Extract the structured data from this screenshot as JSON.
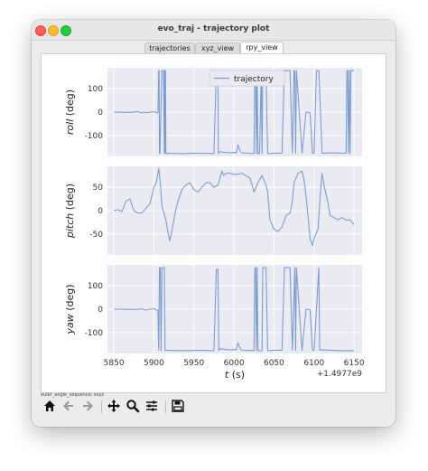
{
  "window": {
    "title": "evo_traj - trajectory plot"
  },
  "tabs": [
    {
      "label": "trajectories",
      "active": false
    },
    {
      "label": "xyz_view",
      "active": false
    },
    {
      "label": "rpy_view",
      "active": true
    }
  ],
  "caption": "euler_angle_sequence: sxyz",
  "toolbar": {
    "icons": [
      "home-icon",
      "back-arrow-icon",
      "forward-arrow-icon",
      "pan-icon",
      "zoom-icon",
      "configure-subplots-icon",
      "save-icon"
    ]
  },
  "colors": {
    "plot_bg": "#eaeaf2",
    "series": "#7b9ccf"
  },
  "chart_data": [
    {
      "type": "line",
      "ylabel_italic": "roll",
      "ylabel_unit": "(deg)",
      "yticks": [
        100,
        0,
        -100
      ],
      "ylim": [
        -190,
        190
      ],
      "xlim": [
        5842,
        6160
      ],
      "legend": {
        "placement": "top-center",
        "entries": [
          "trajectory"
        ]
      },
      "grid": true,
      "series": [
        {
          "name": "trajectory",
          "x": [
            5850,
            5870,
            5880,
            5885,
            5888,
            5890,
            5895,
            5900,
            5902,
            5903,
            5904,
            5905,
            5906,
            5906.5,
            5907,
            5907.5,
            5910,
            5911,
            5912,
            5913,
            5913.5,
            5914,
            5914.5,
            5915,
            5917,
            5918,
            5920,
            5935,
            5950,
            5965,
            5975,
            5978,
            5980,
            5980.5,
            5982,
            5995,
            6000,
            6003,
            6005,
            6008,
            6010,
            6020,
            6025,
            6026,
            6027,
            6028,
            6029,
            6030,
            6032,
            6034,
            6035,
            6036,
            6037,
            6040,
            6042,
            6043,
            6050,
            6060,
            6063,
            6070,
            6073,
            6075,
            6076,
            6077,
            6078,
            6085,
            6090,
            6095,
            6098,
            6100,
            6103,
            6106,
            6110,
            6120,
            6135,
            6140,
            6141,
            6142,
            6143,
            6144,
            6145,
            6146,
            6150
          ],
          "y": [
            0,
            -1,
            2,
            -4,
            0,
            -3,
            0,
            2,
            -1,
            -2,
            -1,
            -3,
            178,
            178,
            -178,
            -178,
            178,
            178,
            178,
            -178,
            178,
            -175,
            178,
            -178,
            -178,
            -176,
            -177,
            -178,
            -176,
            -177,
            -178,
            170,
            170,
            -178,
            -170,
            -175,
            -173,
            -175,
            -140,
            -170,
            -175,
            -177,
            -178,
            178,
            178,
            -178,
            178,
            -178,
            -178,
            178,
            -178,
            178,
            178,
            178,
            -178,
            -178,
            -176,
            -176,
            178,
            178,
            -176,
            178,
            178,
            -178,
            178,
            -177,
            0,
            -2,
            -176,
            -178,
            178,
            178,
            -176,
            -175,
            -176,
            -176,
            178,
            178,
            -178,
            178,
            -178,
            178,
            178
          ]
        }
      ]
    },
    {
      "type": "line",
      "ylabel_italic": "pitch",
      "ylabel_unit": "(deg)",
      "yticks": [
        50,
        0,
        -50
      ],
      "ylim": [
        -95,
        95
      ],
      "xlim": [
        5842,
        6160
      ],
      "grid": true,
      "series": [
        {
          "name": "trajectory",
          "x": [
            5850,
            5855,
            5860,
            5862,
            5865,
            5870,
            5875,
            5880,
            5885,
            5890,
            5895,
            5900,
            5903,
            5906,
            5908,
            5910,
            5915,
            5918,
            5920,
            5925,
            5927,
            5930,
            5935,
            5940,
            5945,
            5950,
            5955,
            5960,
            5965,
            5970,
            5975,
            5980,
            5985,
            5987,
            5990,
            5995,
            6000,
            6005,
            6010,
            6015,
            6020,
            6025,
            6030,
            6035,
            6040,
            6042,
            6045,
            6050,
            6055,
            6060,
            6065,
            6070,
            6073,
            6075,
            6080,
            6085,
            6088,
            6090,
            6093,
            6095,
            6098,
            6100,
            6105,
            6108,
            6110,
            6113,
            6117,
            6120,
            6125,
            6130,
            6135,
            6140,
            6145,
            6150
          ],
          "y": [
            0,
            2,
            -2,
            5,
            20,
            25,
            0,
            -5,
            -5,
            5,
            15,
            50,
            60,
            90,
            60,
            10,
            -20,
            -50,
            -65,
            -20,
            0,
            20,
            45,
            55,
            60,
            45,
            40,
            50,
            60,
            60,
            50,
            55,
            85,
            75,
            80,
            80,
            78,
            78,
            80,
            75,
            70,
            40,
            60,
            75,
            55,
            40,
            -20,
            -40,
            -45,
            -35,
            -10,
            -5,
            20,
            60,
            80,
            85,
            60,
            30,
            -20,
            -60,
            -75,
            -60,
            -40,
            40,
            80,
            50,
            20,
            -10,
            -15,
            -20,
            -15,
            -20,
            -20,
            -30
          ]
        }
      ]
    },
    {
      "type": "line",
      "ylabel_italic": "yaw",
      "ylabel_unit": "(deg)",
      "yticks": [
        100,
        0,
        -100
      ],
      "ylim": [
        -190,
        190
      ],
      "xlim": [
        5842,
        6160
      ],
      "xticks": [
        5850,
        5900,
        5950,
        6000,
        6050,
        6100,
        6150
      ],
      "xlabel_italic": "t",
      "xlabel_unit": "(s)",
      "offset_text": "+1.4977e9",
      "grid": true,
      "series": [
        {
          "name": "trajectory",
          "x": [
            5850,
            5880,
            5885,
            5890,
            5895,
            5900,
            5902,
            5903,
            5904,
            5905,
            5906,
            5907,
            5908,
            5909,
            5910,
            5913,
            5914,
            5915,
            5920,
            5940,
            5960,
            5975,
            5978,
            5980,
            5981,
            5982,
            5995,
            6000,
            6003,
            6005,
            6008,
            6010,
            6020,
            6025,
            6026,
            6027,
            6028,
            6029,
            6030,
            6032,
            6035,
            6036,
            6037,
            6040,
            6042,
            6043,
            6050,
            6060,
            6063,
            6070,
            6073,
            6076,
            6077,
            6078,
            6085,
            6090,
            6095,
            6098,
            6100,
            6106,
            6107,
            6110,
            6120,
            6135,
            6145,
            6150
          ],
          "y": [
            0,
            -1,
            2,
            -4,
            0,
            2,
            -1,
            -3,
            -5,
            -4,
            -176,
            178,
            178,
            -178,
            178,
            178,
            -178,
            -176,
            -177,
            -178,
            -176,
            -178,
            170,
            170,
            -178,
            -170,
            -175,
            -173,
            -175,
            -145,
            -170,
            -176,
            -177,
            -178,
            178,
            178,
            -178,
            178,
            -178,
            -178,
            -178,
            178,
            178,
            178,
            -178,
            -178,
            -176,
            -176,
            178,
            178,
            -176,
            178,
            -178,
            178,
            -177,
            0,
            -2,
            -176,
            -178,
            178,
            -176,
            -175,
            -176,
            -178,
            -178,
            -178
          ]
        }
      ]
    }
  ]
}
